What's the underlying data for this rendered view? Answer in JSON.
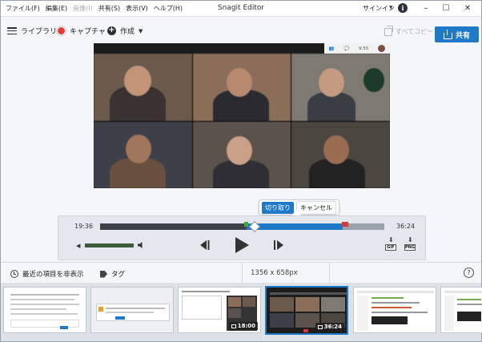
{
  "titlebar": {
    "menus": [
      {
        "label": "ファイル(F)",
        "disabled": false
      },
      {
        "label": "編集(E)",
        "disabled": false
      },
      {
        "label": "画像(I)",
        "disabled": true
      },
      {
        "label": "共有(S)",
        "disabled": false
      },
      {
        "label": "表示(V)",
        "disabled": false
      },
      {
        "label": "ヘルプ(H)",
        "disabled": false
      }
    ],
    "title": "Snagit Editor",
    "signin": "サインイン",
    "info_icon": "i",
    "minimize": "–",
    "maximize": "☐",
    "close": "✕"
  },
  "toolbar": {
    "library": "ライブラリ",
    "capture": "キャプチャ",
    "create": "作成",
    "copy_all": "すべてコピー",
    "share": "共有"
  },
  "video": {
    "topbar": [
      "👥",
      "💬",
      "9:55",
      ""
    ]
  },
  "trim_popover": {
    "cut": "切り取り",
    "cancel": "キャンセル"
  },
  "player": {
    "start_time": "19:36",
    "end_time": "36:24",
    "volume_level": 1.0,
    "gif_label": "GIF",
    "png_label": "PNG"
  },
  "statusbar": {
    "hide_recent": "最近の項目を非表示",
    "tag": "タグ",
    "dimensions": "1356 x 658px",
    "help": "?"
  },
  "tray": {
    "thumbnails": [
      {
        "kind": "document",
        "badge": ""
      },
      {
        "kind": "dialog",
        "badge": ""
      },
      {
        "kind": "video",
        "badge": "18:00"
      },
      {
        "kind": "video",
        "badge": "36:24",
        "selected": true
      },
      {
        "kind": "code",
        "badge": ""
      },
      {
        "kind": "code",
        "badge": ""
      }
    ]
  },
  "colors": {
    "accent": "#1f78c8",
    "record": "#e53935",
    "trim_start": "#3aa83a",
    "trim_end": "#d93636"
  }
}
